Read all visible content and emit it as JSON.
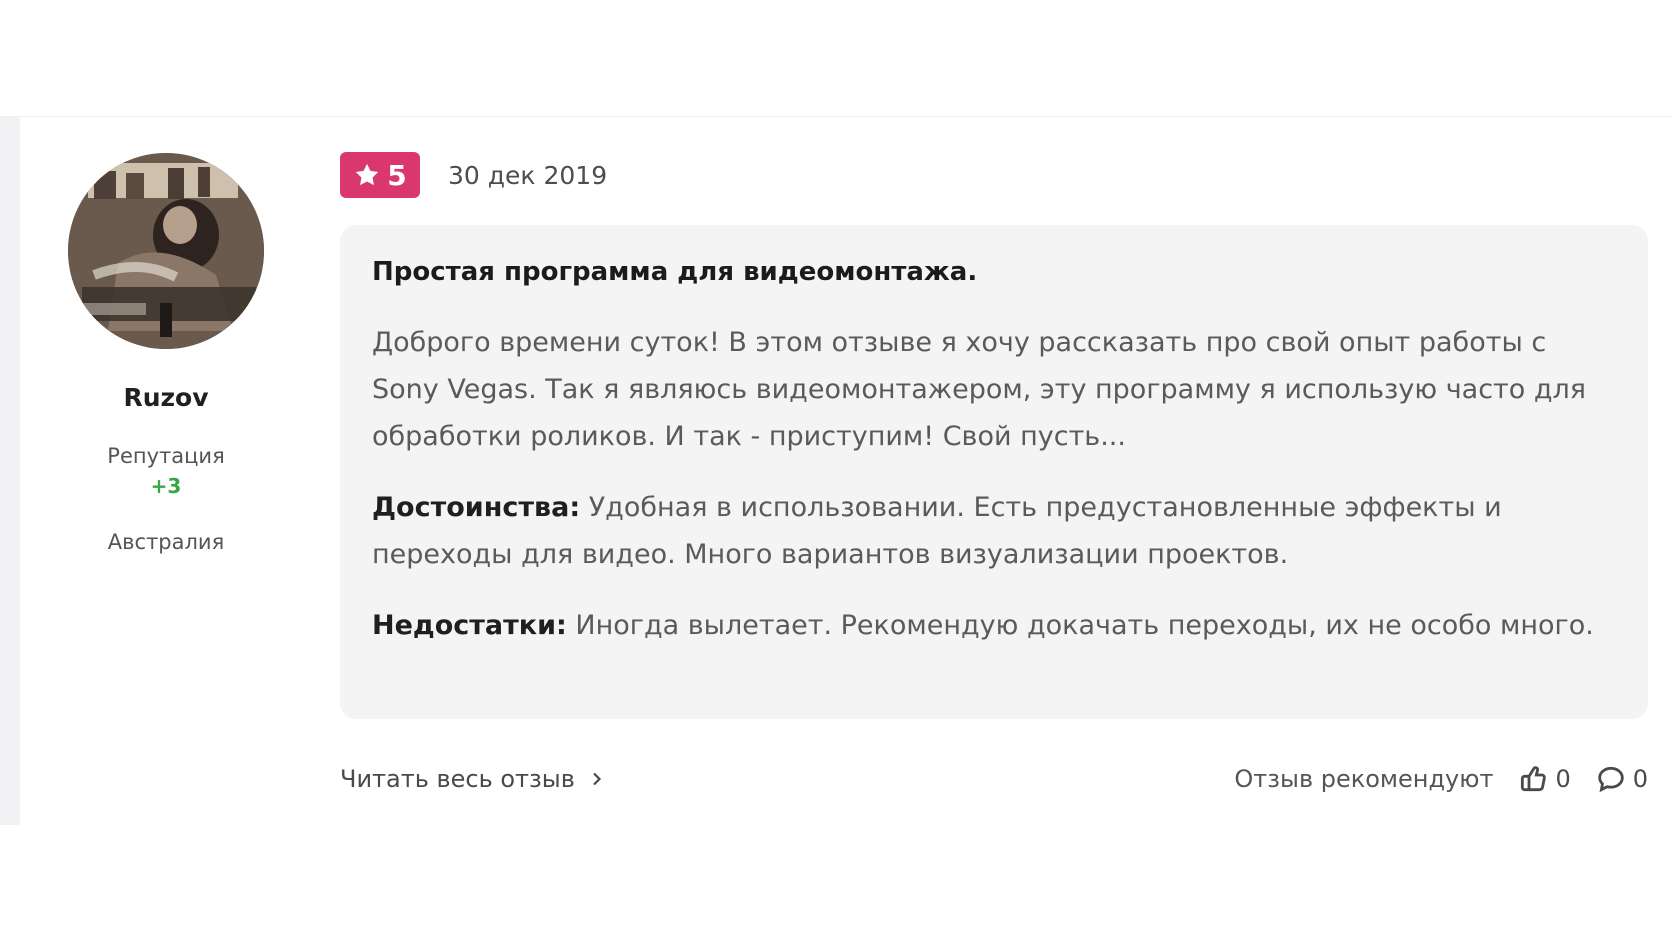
{
  "author": {
    "avatar_description": "avatar",
    "name": "Ruzov",
    "reputation_label": "Репутация",
    "reputation_value": "+3",
    "country": "Австралия"
  },
  "review": {
    "rating": "5",
    "date": "30 дек 2019",
    "title": "Простая программа для видеомонтажа.",
    "body": "Доброго времени суток! В этом отзыве я хочу рассказать про свой опыт работы с Sony Vegas. Так я являюсь видеомонтажером, эту программу я использую часто для обработки роликов. И так - приступим! Свой пусть...",
    "pros_label": "Достоинства:",
    "pros_text": " Удобная в использовании. Есть предустановленные эффекты и переходы для видео. Много вариантов визуализации проектов.",
    "cons_label": "Недостатки:",
    "cons_text": " Иногда вылетает. Рекомендую докачать переходы, их не особо много."
  },
  "footer": {
    "read_full_label": "Читать весь отзыв",
    "recommend_label": "Отзыв рекомендуют",
    "likes_count": "0",
    "comments_count": "0"
  },
  "icons": {
    "rating": "star-icon",
    "read_more": "chevron-right-icon",
    "like": "thumbs-up-icon",
    "comment": "comment-icon"
  },
  "colors": {
    "rating_badge": "#d9376e",
    "reputation_positive": "#36a646",
    "review_box_bg": "#f4f4f5"
  }
}
